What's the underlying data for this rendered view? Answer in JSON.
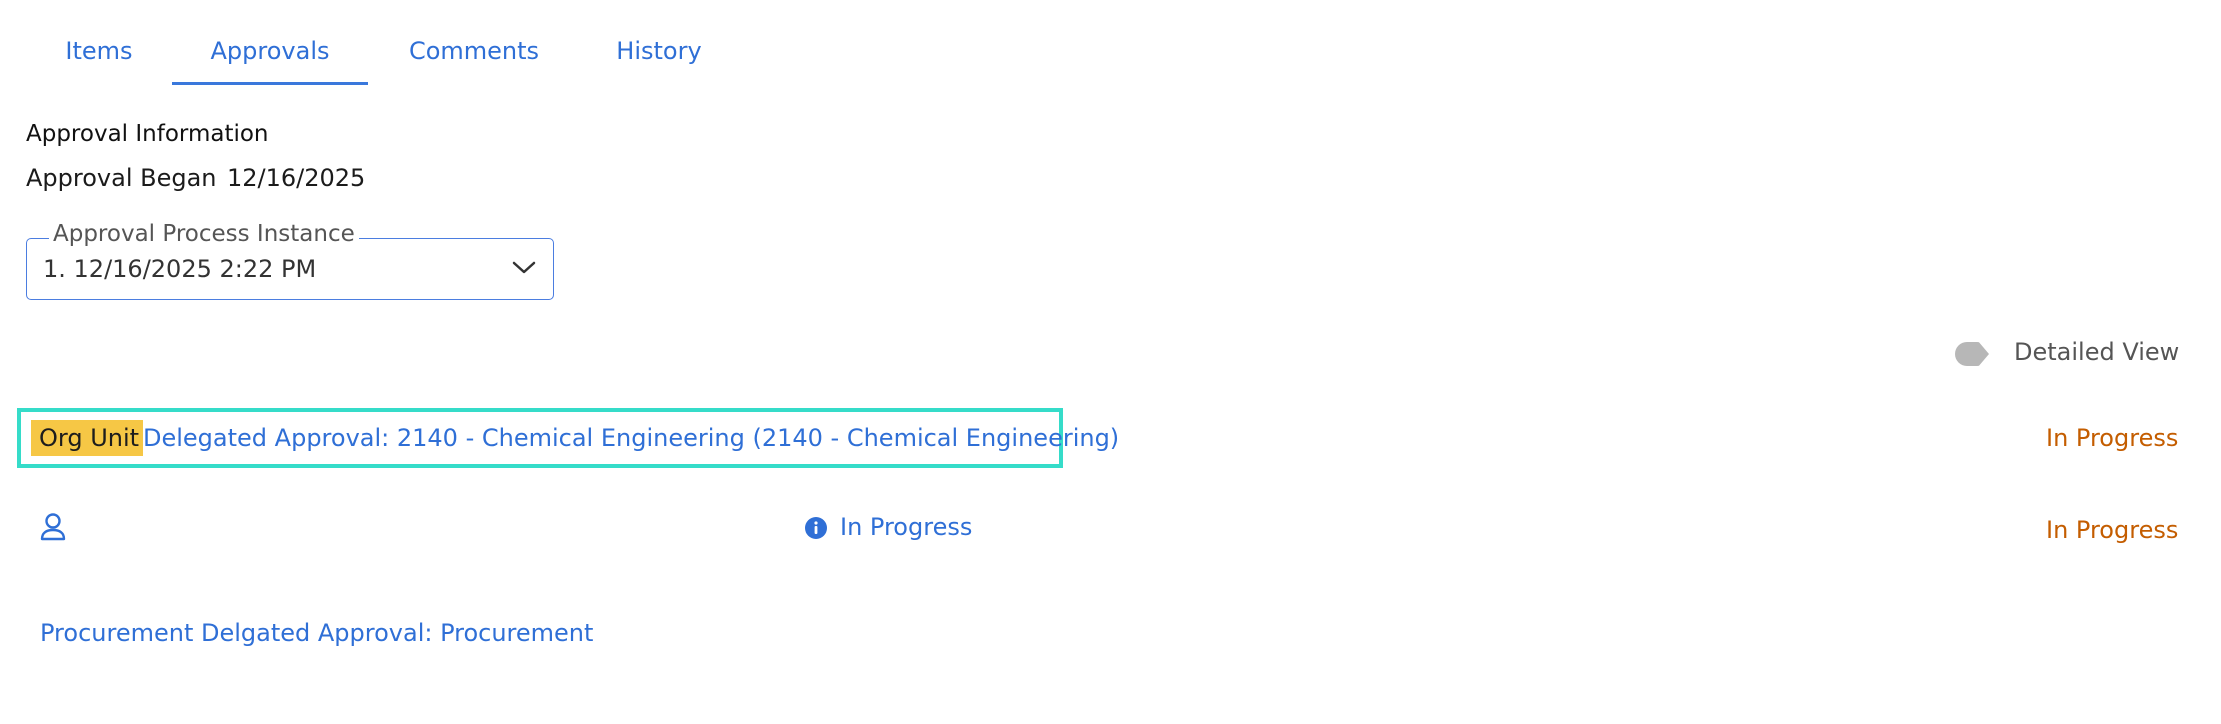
{
  "tabs": [
    {
      "label": "Items"
    },
    {
      "label": "Approvals"
    },
    {
      "label": "Comments"
    },
    {
      "label": "History"
    }
  ],
  "approval_info": {
    "title": "Approval Information",
    "began_label": "Approval Began",
    "began_date": "12/16/2025"
  },
  "instance_select": {
    "legend": "Approval Process Instance",
    "value": "1. 12/16/2025 2:22 PM",
    "icon": "chevron-down-icon"
  },
  "toggle": {
    "label": "Detailed View",
    "on": false
  },
  "approvals": [
    {
      "badge": "Org Unit",
      "link": "Delegated Approval: 2140 - Chemical Engineering (2140 - Chemical Engineering)",
      "status": "In Progress"
    },
    {
      "icon": "user-icon",
      "info_icon": "info-icon",
      "mid_status": "In Progress",
      "status": "In Progress"
    },
    {
      "link": "Procurement Delgated Approval: Procurement"
    }
  ],
  "colors": {
    "link": "#2f6fd6",
    "status_orange": "#c45d00",
    "badge": "#f6c745",
    "highlight": "#35dcc9"
  }
}
